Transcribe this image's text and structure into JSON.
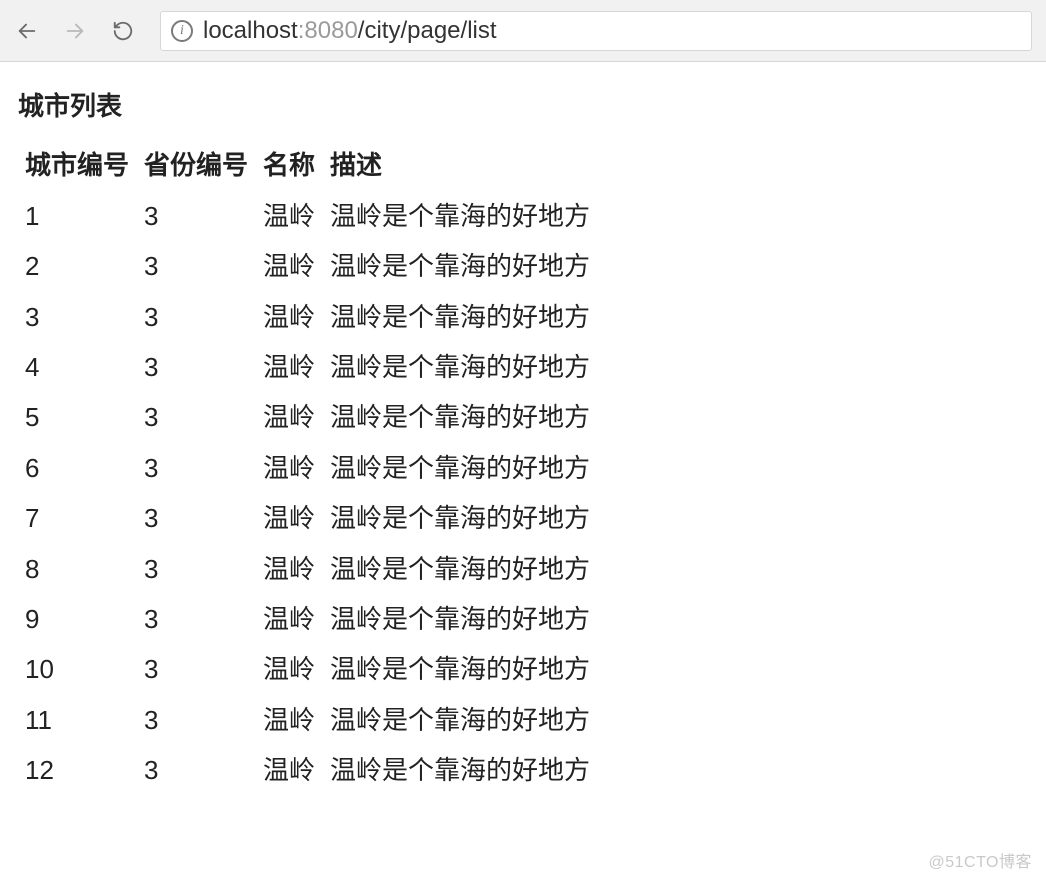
{
  "browser": {
    "url_host": "localhost",
    "url_port": ":8080",
    "url_path": "/city/page/list",
    "info_glyph": "i"
  },
  "page": {
    "title": "城市列表"
  },
  "table": {
    "headers": {
      "city_id": "城市编号",
      "province_id": "省份编号",
      "name": "名称",
      "description": "描述"
    },
    "rows": [
      {
        "city_id": "1",
        "province_id": "3",
        "name": "温岭",
        "description": "温岭是个靠海的好地方"
      },
      {
        "city_id": "2",
        "province_id": "3",
        "name": "温岭",
        "description": "温岭是个靠海的好地方"
      },
      {
        "city_id": "3",
        "province_id": "3",
        "name": "温岭",
        "description": "温岭是个靠海的好地方"
      },
      {
        "city_id": "4",
        "province_id": "3",
        "name": "温岭",
        "description": "温岭是个靠海的好地方"
      },
      {
        "city_id": "5",
        "province_id": "3",
        "name": "温岭",
        "description": "温岭是个靠海的好地方"
      },
      {
        "city_id": "6",
        "province_id": "3",
        "name": "温岭",
        "description": "温岭是个靠海的好地方"
      },
      {
        "city_id": "7",
        "province_id": "3",
        "name": "温岭",
        "description": "温岭是个靠海的好地方"
      },
      {
        "city_id": "8",
        "province_id": "3",
        "name": "温岭",
        "description": "温岭是个靠海的好地方"
      },
      {
        "city_id": "9",
        "province_id": "3",
        "name": "温岭",
        "description": "温岭是个靠海的好地方"
      },
      {
        "city_id": "10",
        "province_id": "3",
        "name": "温岭",
        "description": "温岭是个靠海的好地方"
      },
      {
        "city_id": "11",
        "province_id": "3",
        "name": "温岭",
        "description": "温岭是个靠海的好地方"
      },
      {
        "city_id": "12",
        "province_id": "3",
        "name": "温岭",
        "description": "温岭是个靠海的好地方"
      }
    ]
  },
  "watermark": "@51CTO博客"
}
